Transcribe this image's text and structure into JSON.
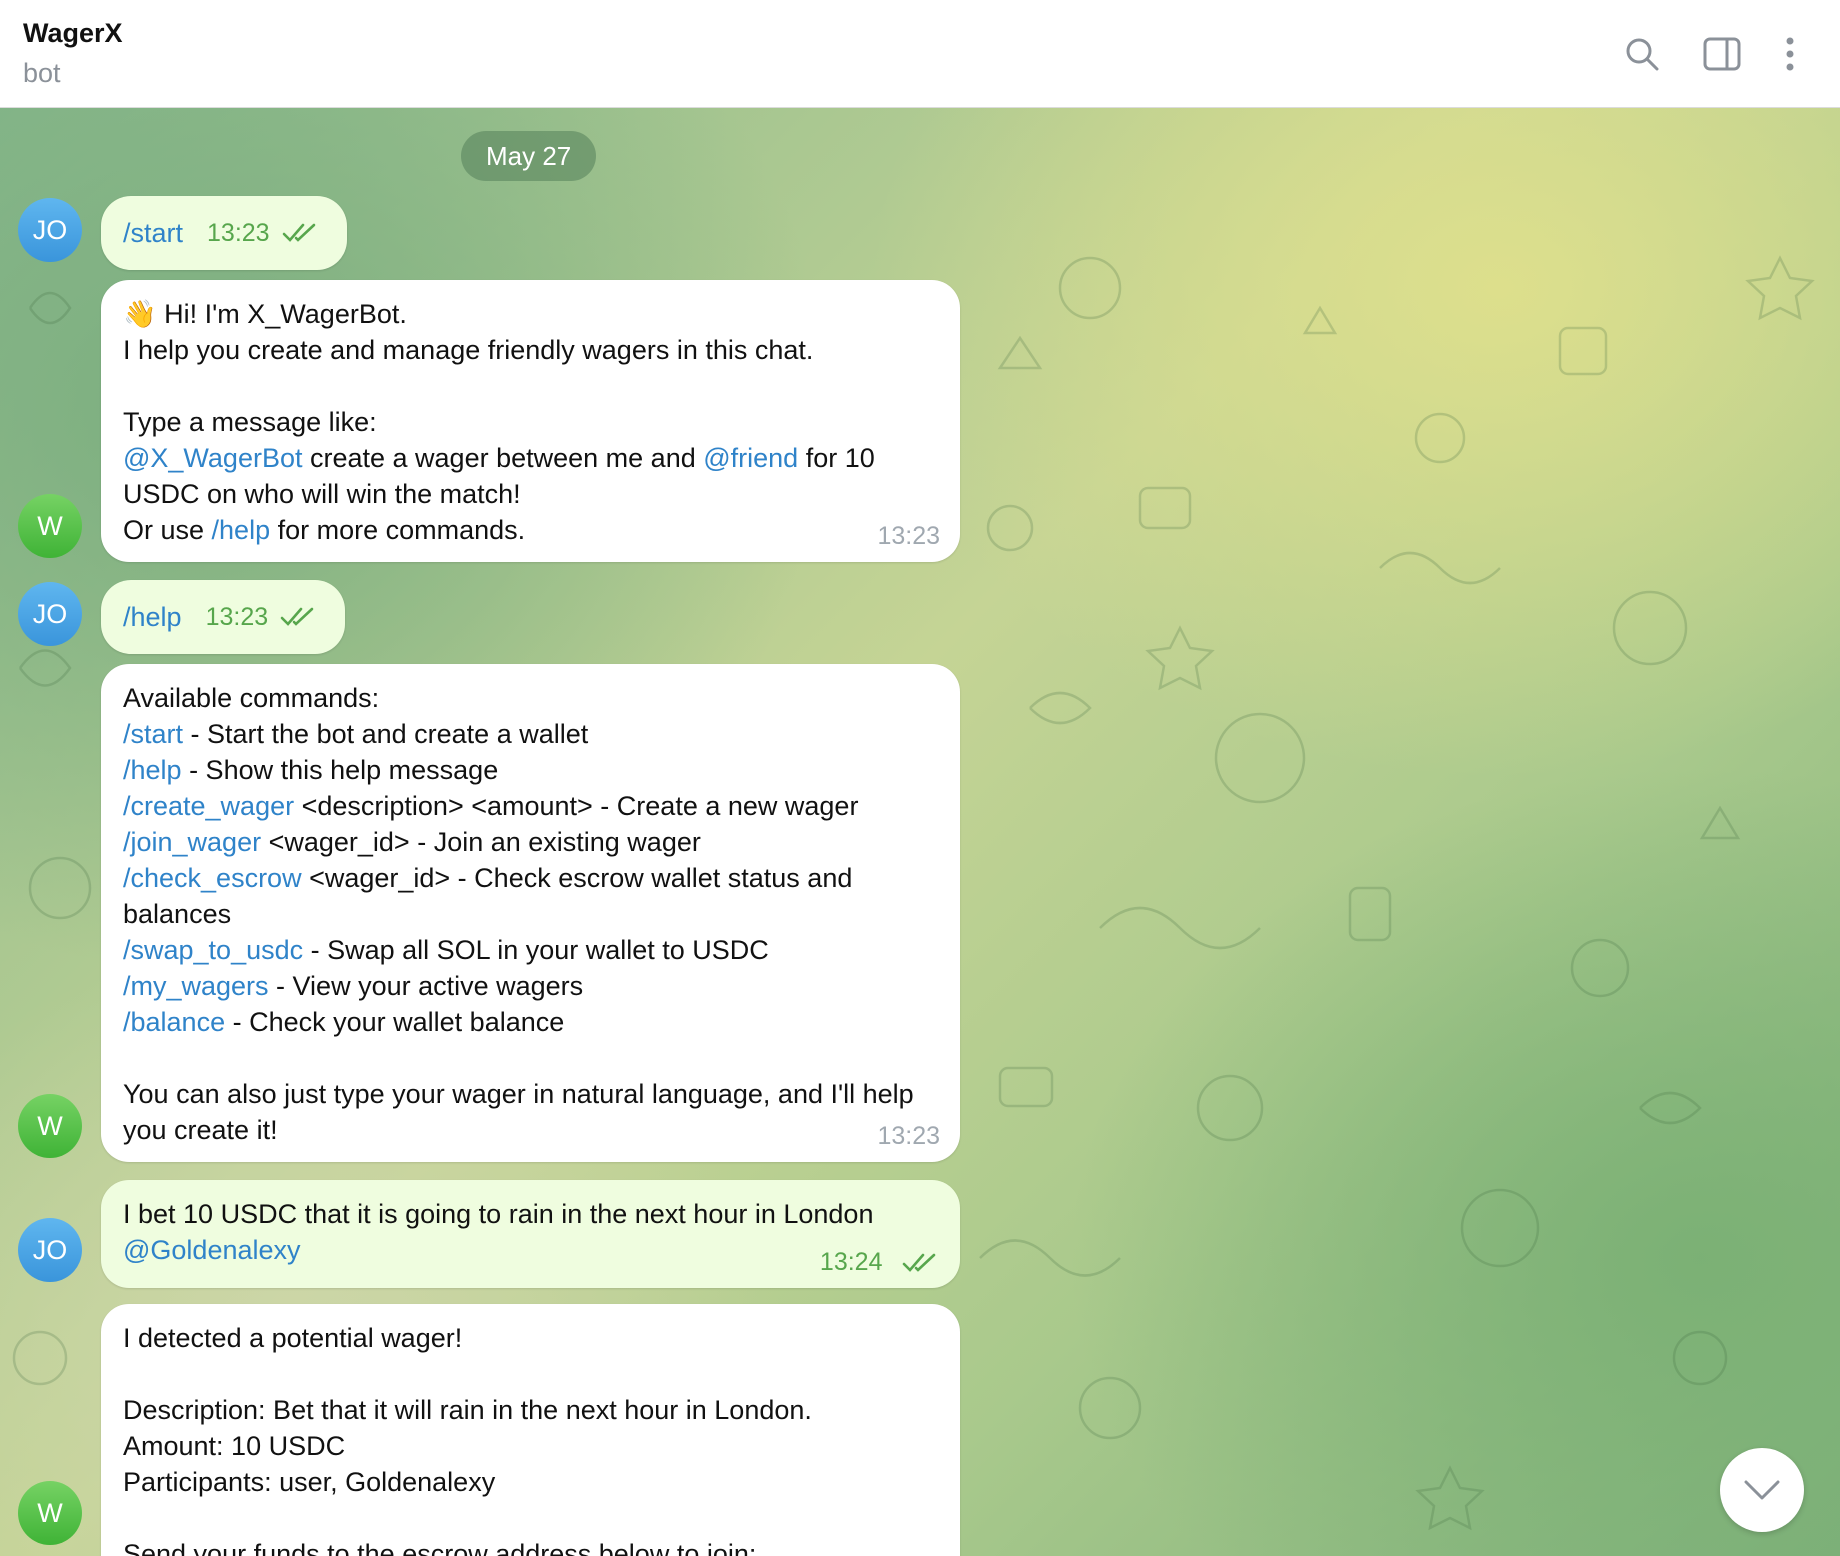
{
  "header": {
    "title": "WagerX",
    "subtitle": "bot",
    "icons": [
      "search-icon",
      "sidebar-toggle-icon",
      "more-vertical-icon"
    ]
  },
  "date_separator": "May 27",
  "messages": [
    {
      "sender": "JO",
      "text": "/start",
      "time": "13:23",
      "status": "read"
    },
    {
      "sender": "W",
      "emoji": "👋",
      "greeting": " Hi! I'm X_WagerBot.",
      "line2": "I help you create and manage friendly wagers in this chat.",
      "line3": "Type a message like:",
      "mention_bot": "@X_WagerBot",
      "line4_mid": " create a wager between me and ",
      "mention_friend": "@friend",
      "line4_end": " for 10",
      "line5": "USDC on who will win the match!",
      "line6_start": "Or use ",
      "help_cmd": "/help",
      "line6_end": " for more commands.",
      "time": "13:23"
    },
    {
      "sender": "JO",
      "text": "/help",
      "time": "13:23",
      "status": "read"
    },
    {
      "sender": "W",
      "heading": "Available commands:",
      "commands": [
        {
          "cmd": "/start",
          "desc": " - Start the bot and create a wallet"
        },
        {
          "cmd": "/help",
          "desc": " - Show this help message"
        },
        {
          "cmd": "/create_wager",
          "desc": " <description> <amount> - Create a new wager"
        },
        {
          "cmd": "/join_wager",
          "desc": " <wager_id> - Join an existing wager"
        },
        {
          "cmd": "/check_escrow",
          "desc": " <wager_id> - Check escrow wallet status and"
        },
        {
          "cmd": "",
          "desc": "balances"
        },
        {
          "cmd": "/swap_to_usdc",
          "desc": " - Swap all SOL in your wallet to USDC"
        },
        {
          "cmd": "/my_wagers",
          "desc": " - View your active wagers"
        },
        {
          "cmd": "/balance",
          "desc": " - Check your wallet balance"
        }
      ],
      "footer_line1": "You can also just type your wager in natural language, and I'll help",
      "footer_line2": "you create it!",
      "time": "13:23"
    },
    {
      "sender": "JO",
      "line1": "I bet 10 USDC that it is going to rain in the next hour in London",
      "mention": "@Goldenalexy",
      "time": "13:24",
      "status": "read"
    },
    {
      "sender": "W",
      "line1": "I detected a potential wager!",
      "line2": "Description: Bet that it will rain in the next hour in London.",
      "line3": "Amount: 10 USDC",
      "line4": "Participants: user, Goldenalexy",
      "line5": "Send your funds to the escrow address below to join:"
    }
  ],
  "avatars": {
    "user": "JO",
    "bot": "W"
  },
  "colors": {
    "link": "#2f83c9",
    "outgoing_bubble": "#effddf",
    "outgoing_time": "#57a64c",
    "incoming_time": "#a0a8b0",
    "avatar_user": "#3a95db",
    "avatar_bot": "#3fb336"
  }
}
